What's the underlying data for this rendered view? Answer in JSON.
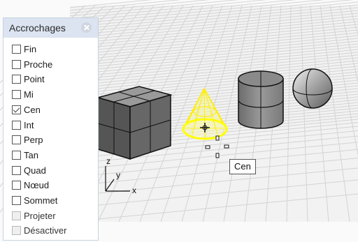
{
  "panel": {
    "title": "Accrochages",
    "items": [
      {
        "label": "Fin",
        "checked": false,
        "disabled": false
      },
      {
        "label": "Proche",
        "checked": false,
        "disabled": false
      },
      {
        "label": "Point",
        "checked": false,
        "disabled": false
      },
      {
        "label": "Mi",
        "checked": false,
        "disabled": false
      },
      {
        "label": "Cen",
        "checked": true,
        "disabled": false
      },
      {
        "label": "Int",
        "checked": false,
        "disabled": false
      },
      {
        "label": "Perp",
        "checked": false,
        "disabled": false
      },
      {
        "label": "Tan",
        "checked": false,
        "disabled": false
      },
      {
        "label": "Quad",
        "checked": false,
        "disabled": false
      },
      {
        "label": "Nœud",
        "checked": false,
        "disabled": false
      },
      {
        "label": "Sommet",
        "checked": false,
        "disabled": false
      },
      {
        "label": "Projeter",
        "checked": false,
        "disabled": true
      },
      {
        "label": "Désactiver",
        "checked": false,
        "disabled": true
      }
    ]
  },
  "viewport": {
    "tooltip": "Cen",
    "axes": {
      "z": "z",
      "y": "y",
      "x": "x"
    }
  },
  "colors": {
    "selection": "#ffff00",
    "panel_header": "#dbe4f0",
    "grid": "#d3d3d3"
  }
}
